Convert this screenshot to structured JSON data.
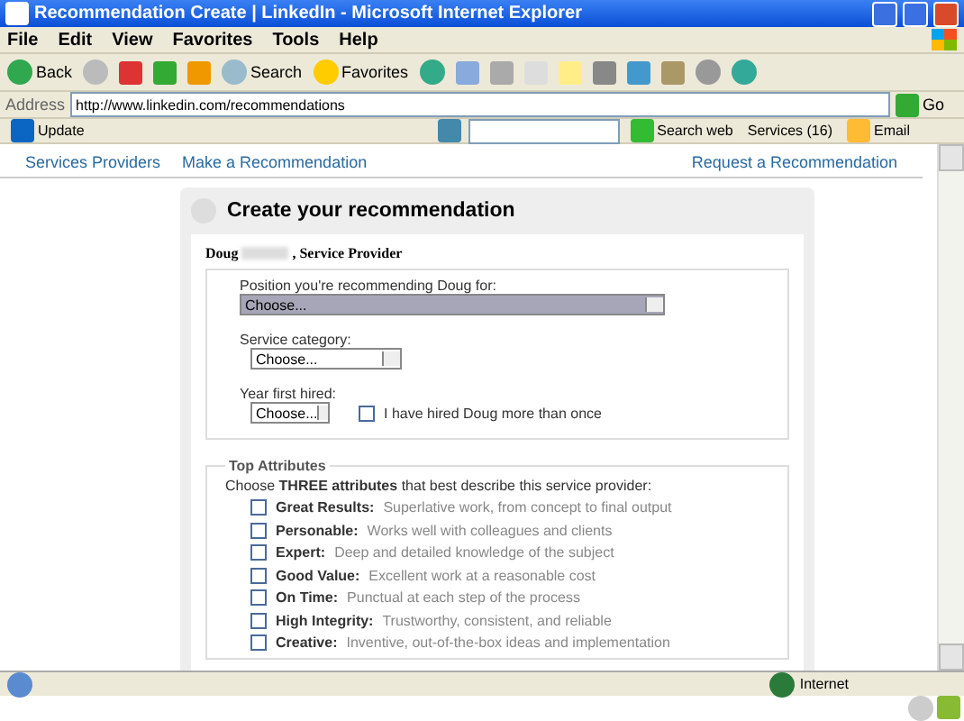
{
  "window": {
    "title": "Recommendation Create | LinkedIn - Microsoft Internet Explorer"
  },
  "menu": [
    "File",
    "Edit",
    "View",
    "Favorites",
    "Tools",
    "Help"
  ],
  "toolbar": {
    "back": "Back",
    "search": "Search",
    "favorites": "Favorites"
  },
  "address": {
    "label": "Address",
    "url": "http://www.linkedin.com/recommendations",
    "go": "Go"
  },
  "links_bar": {
    "update": "Update",
    "search_web": "Search web",
    "services": "Services (16)",
    "email": "Email"
  },
  "nav": {
    "left": [
      "Services Providers",
      "Make a Recommendation"
    ],
    "right": "Request a Recommendation"
  },
  "form": {
    "title": "Create your recommendation",
    "provider_first": "Doug",
    "provider_suffix": ", Service Provider",
    "position_label": "Position you're recommending Doug for:",
    "position_value": "Choose...",
    "category_label": "Service category:",
    "category_value": "Choose...",
    "year_label": "Year first hired:",
    "year_value": "Choose...",
    "hired_more": {
      "label": "I have hired Doug more than once",
      "checked": false
    },
    "attributes_legend": "Top Attributes",
    "attributes_intro": "Choose **THREE attributes** that best describe this service provider:",
    "attributes": [
      {
        "name": "Great Results:",
        "description": "Superlative work, from concept to final output",
        "checked": false
      },
      {
        "name": "Personable:",
        "description": "Works well with colleagues and clients",
        "checked": false
      },
      {
        "name": "Expert:",
        "description": "Deep and detailed knowledge of the subject",
        "checked": false
      },
      {
        "name": "Good Value:",
        "description": "Excellent work at a reasonable cost",
        "checked": false
      },
      {
        "name": "On Time:",
        "description": "Punctual at each step of the process",
        "checked": false
      },
      {
        "name": "High Integrity:",
        "description": "Trustworthy, consistent, and reliable",
        "checked": false
      },
      {
        "name": "Creative:",
        "description": "Inventive, out-of-the-box ideas and implementation",
        "checked": false
      }
    ]
  },
  "status_bar": {
    "zone": "Internet"
  }
}
